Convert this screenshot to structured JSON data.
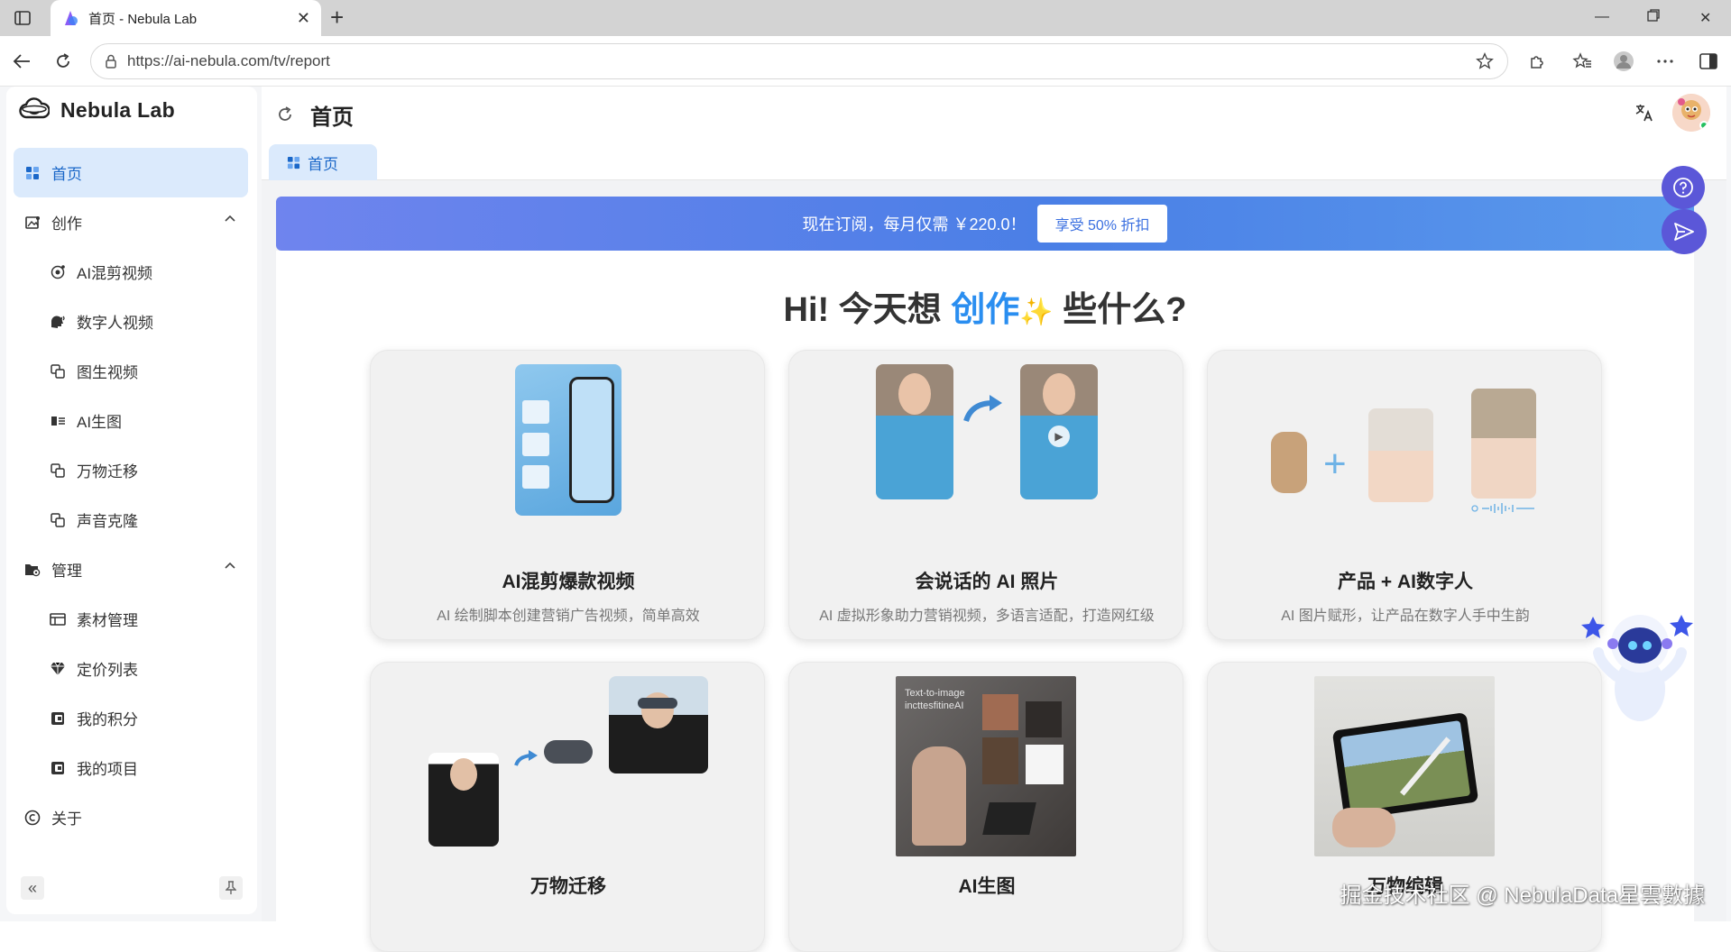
{
  "browser": {
    "tab_title": "首页 - Nebula Lab",
    "url": "https://ai-nebula.com/tv/report"
  },
  "sidebar": {
    "brand": "Nebula Lab",
    "items": [
      {
        "label": "首页",
        "icon": "dashboard-icon"
      },
      {
        "label": "创作",
        "icon": "image-edit-icon"
      },
      {
        "label": "AI混剪视频",
        "icon": "video-camera-icon"
      },
      {
        "label": "数字人视频",
        "icon": "speaking-head-icon"
      },
      {
        "label": "图生视频",
        "icon": "copy-icon"
      },
      {
        "label": "AI生图",
        "icon": "id-card-icon"
      },
      {
        "label": "万物迁移",
        "icon": "copy-icon"
      },
      {
        "label": "声音克隆",
        "icon": "copy-icon"
      },
      {
        "label": "管理",
        "icon": "folder-settings-icon"
      },
      {
        "label": "素材管理",
        "icon": "grid-table-icon"
      },
      {
        "label": "定价列表",
        "icon": "diamond-icon"
      },
      {
        "label": "我的积分",
        "icon": "wallet-icon"
      },
      {
        "label": "我的项目",
        "icon": "wallet-icon"
      },
      {
        "label": "关于",
        "icon": "copyright-icon"
      }
    ]
  },
  "header": {
    "title": "首页",
    "page_tab": "首页"
  },
  "promo": {
    "text": "现在订阅，每月仅需 ￥220.0！",
    "button": "享受 50% 折扣"
  },
  "hero": {
    "part1": "Hi!  今天想 ",
    "accent": "创作",
    "part2": " 些什么?"
  },
  "cards": [
    {
      "title": "AI混剪爆款视频",
      "desc": "AI 绘制脚本创建营销广告视频，简单高效"
    },
    {
      "title": "会说话的 AI 照片",
      "desc": "AI 虚拟形象助力营销视频，多语言适配，打造网红级"
    },
    {
      "title": "产品 + AI数字人",
      "desc": "AI 图片赋形，让产品在数字人手中生韵"
    },
    {
      "title": "万物迁移",
      "desc": ""
    },
    {
      "title": "AI生图",
      "desc": "",
      "image_caption": "Text-to-image incttesfitineAI"
    },
    {
      "title": "万物编辑",
      "desc": ""
    }
  ],
  "watermark": "掘金技术社区 @ NebulaData星雲數據",
  "colors": {
    "accent": "#2a8ef0",
    "active_bg": "#dbeafc",
    "fab": "#5b57d8"
  }
}
